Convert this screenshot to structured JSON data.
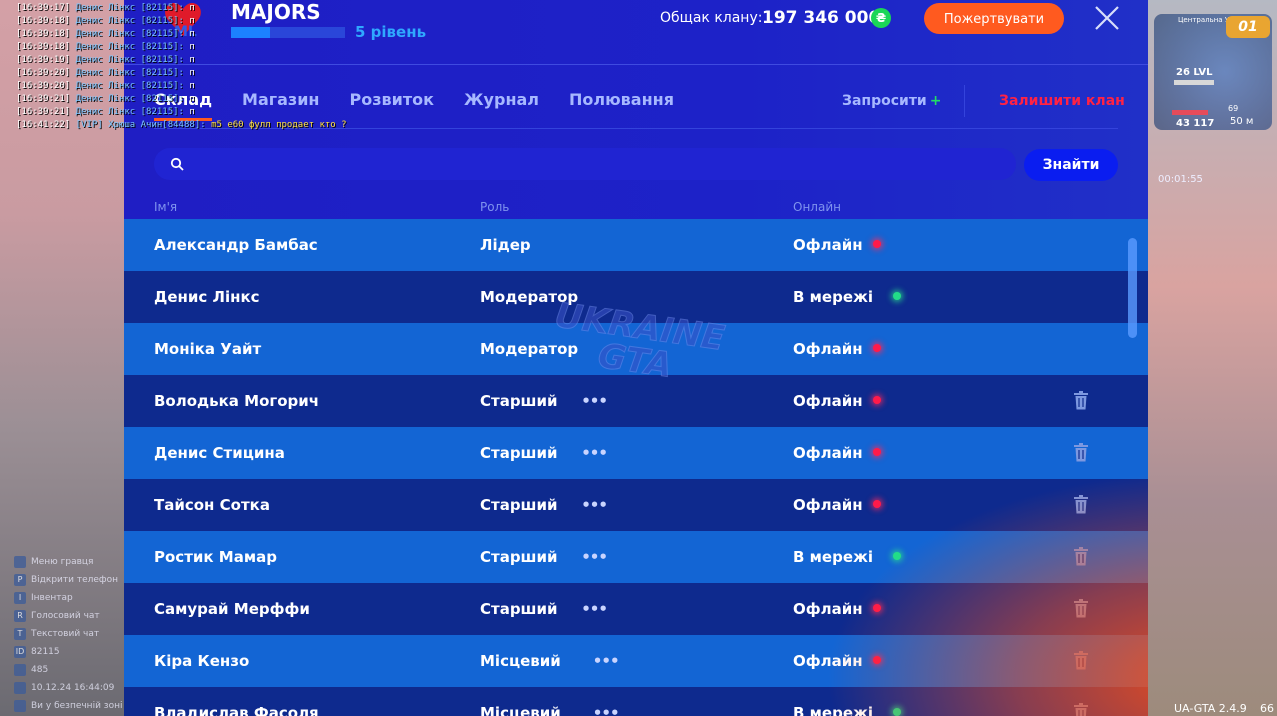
{
  "clan": {
    "name": "MAJORS",
    "level": "5 рівень",
    "xp_fraction": 0.34,
    "bank_label": "Общак клану:",
    "bank_value": "197 346 000",
    "currency_icon": "hryvnia-coin-icon",
    "currency_symbol": "₴",
    "donate_label": "Пожертвувати"
  },
  "tabs": [
    {
      "label": "Склад",
      "active": true
    },
    {
      "label": "Магазин",
      "active": false
    },
    {
      "label": "Розвиток",
      "active": false
    },
    {
      "label": "Журнал",
      "active": false
    },
    {
      "label": "Полювання",
      "active": false
    }
  ],
  "actions": {
    "invite_label": "Запросити",
    "invite_plus": "+",
    "leave_label": "Залишити клан"
  },
  "search": {
    "placeholder": "",
    "button_label": "Знайти"
  },
  "columns": {
    "name": "Ім'я",
    "role": "Роль",
    "online": "Онлайн"
  },
  "members": [
    {
      "name": "Александр Бамбас",
      "role": "Лідер",
      "status": "Офлайн",
      "online": false,
      "has_menu": false,
      "can_delete": false
    },
    {
      "name": "Денис Лінкс",
      "role": "Модератор",
      "status": "В мережі",
      "online": true,
      "has_menu": false,
      "can_delete": false
    },
    {
      "name": "Моніка Уайт",
      "role": "Модератор",
      "status": "Офлайн",
      "online": false,
      "has_menu": false,
      "can_delete": false
    },
    {
      "name": "Володька Могорич",
      "role": "Старший",
      "status": "Офлайн",
      "online": false,
      "has_menu": true,
      "can_delete": true
    },
    {
      "name": "Денис Стицина",
      "role": "Старший",
      "status": "Офлайн",
      "online": false,
      "has_menu": true,
      "can_delete": true
    },
    {
      "name": "Тайсон Сотка",
      "role": "Старший",
      "status": "Офлайн",
      "online": false,
      "has_menu": true,
      "can_delete": true
    },
    {
      "name": "Ростик Мамар",
      "role": "Старший",
      "status": "В мережі",
      "online": true,
      "has_menu": true,
      "can_delete": true
    },
    {
      "name": "Самурай Мерффи",
      "role": "Старший",
      "status": "Офлайн",
      "online": false,
      "has_menu": true,
      "can_delete": true
    },
    {
      "name": "Кіра Кензо",
      "role": "Місцевий",
      "status": "Офлайн",
      "online": false,
      "has_menu": true,
      "can_delete": true
    },
    {
      "name": "Владислав Фасоля",
      "role": "Місцевий",
      "status": "В мережі",
      "online": true,
      "has_menu": true,
      "can_delete": true
    }
  ],
  "menu_dots": "•••",
  "watermark": {
    "line1": "UKRAINE",
    "line2": "GTA"
  },
  "chat": [
    {
      "time": "[16:39:17]",
      "sender": "Денис Лінкс [82115]:",
      "text": "п"
    },
    {
      "time": "[16:39:18]",
      "sender": "Денис Лінкс [82115]:",
      "text": "п"
    },
    {
      "time": "[16:39:18]",
      "sender": "Денис Лінкс [82115]:",
      "text": "п"
    },
    {
      "time": "[16:39:18]",
      "sender": "Денис Лінкс [82115]:",
      "text": "п"
    },
    {
      "time": "[16:39:19]",
      "sender": "Денис Лінкс [82115]:",
      "text": "п"
    },
    {
      "time": "[16:39:20]",
      "sender": "Денис Лінкс [82115]:",
      "text": "п"
    },
    {
      "time": "[16:39:20]",
      "sender": "Денис Лінкс [82115]:",
      "text": "п"
    },
    {
      "time": "[16:39:21]",
      "sender": "Денис Лінкс [82115]:",
      "text": "п"
    },
    {
      "time": "[16:39:21]",
      "sender": "Денис Лінкс [82115]:",
      "text": "п"
    }
  ],
  "chat_last": {
    "time": "[16:41:22]",
    "sender": "[VIP] Хрюша Ачин[84488]:",
    "text": "m5 e60 фулл продает кто ?"
  },
  "left_hud": [
    {
      "key": "",
      "label": "Меню гравця"
    },
    {
      "key": "P",
      "label": "Відкрити телефон"
    },
    {
      "key": "I",
      "label": "Інвентар"
    },
    {
      "key": "R",
      "label": "Голосовий чат"
    },
    {
      "key": "T",
      "label": "Текстовий чат"
    },
    {
      "key": "ID",
      "label": "82115"
    },
    {
      "key": "",
      "label": "485"
    },
    {
      "key": "",
      "label": "10.12.24 16:44:09"
    },
    {
      "key": "",
      "label": "Ви у безпечній зоні"
    }
  ],
  "right_hud": {
    "map_label": "Центральна Україна",
    "badge": "01",
    "level": "26 LVL",
    "small_value": "69",
    "health": "43 117",
    "speed": "50 м",
    "timer": "00:01:55",
    "version": "UA-GTA 2.4.9",
    "fps": "66"
  }
}
